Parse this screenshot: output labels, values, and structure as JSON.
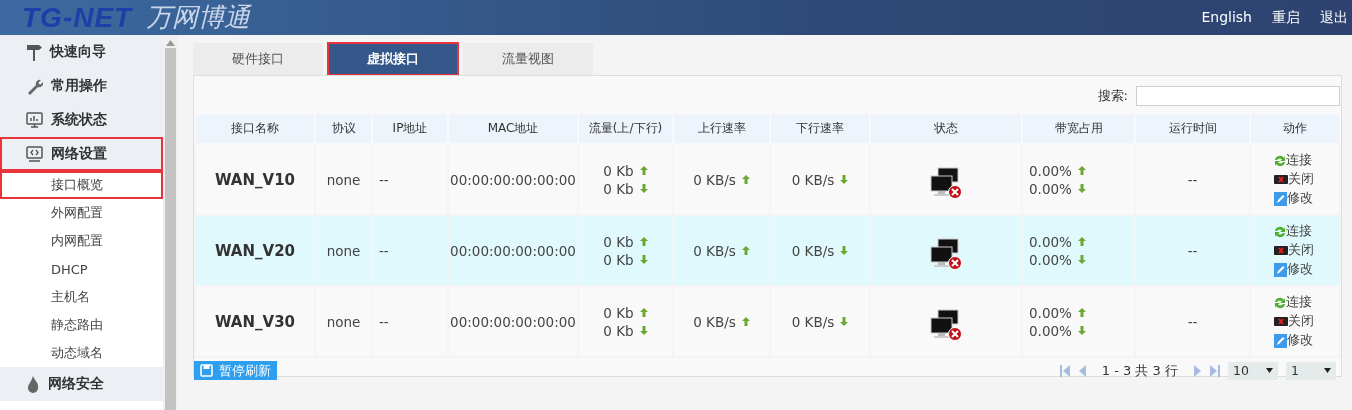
{
  "header": {
    "logo_latin": "TG-NET",
    "logo_cn": "万网博通",
    "links": [
      "English",
      "重启",
      "退出"
    ]
  },
  "sidebar": {
    "items": [
      {
        "label": "快速向导",
        "highlighted": false
      },
      {
        "label": "常用操作",
        "highlighted": false
      },
      {
        "label": "系统状态",
        "highlighted": false
      },
      {
        "label": "网络设置",
        "highlighted": true,
        "children": [
          {
            "label": "接口概览",
            "highlighted": true
          },
          {
            "label": "外网配置",
            "highlighted": false
          },
          {
            "label": "内网配置",
            "highlighted": false
          },
          {
            "label": "DHCP",
            "highlighted": false
          },
          {
            "label": "主机名",
            "highlighted": false
          },
          {
            "label": "静态路由",
            "highlighted": false
          },
          {
            "label": "动态域名",
            "highlighted": false
          }
        ]
      },
      {
        "label": "网络安全",
        "highlighted": false
      }
    ]
  },
  "tabs": [
    {
      "label": "硬件接口",
      "selected": false,
      "highlighted": false
    },
    {
      "label": "虚拟接口",
      "selected": true,
      "highlighted": true
    },
    {
      "label": "流量视图",
      "selected": false,
      "highlighted": false
    }
  ],
  "search": {
    "label": "搜索:"
  },
  "table": {
    "columns": [
      "接口名称",
      "协议",
      "IP地址",
      "MAC地址",
      "流量(上/下行)",
      "上行速率",
      "下行速率",
      "状态",
      "带宽占用",
      "运行时间",
      "动作"
    ],
    "rows": [
      {
        "name": "WAN_V10",
        "protocol": "none",
        "ip": "--",
        "mac": "00:00:00:00:00:00",
        "traffic_up": "0 Kb",
        "traffic_down": "0 Kb",
        "up_rate": "0 KB/s",
        "down_rate": "0 KB/s",
        "connected": false,
        "bandwidth_up": "0.00%",
        "bandwidth_down": "0.00%",
        "uptime": "--",
        "selected": false,
        "actions": [
          {
            "label": "连接",
            "kind": "connect"
          },
          {
            "label": "关闭",
            "kind": "close"
          },
          {
            "label": "修改",
            "kind": "edit"
          }
        ]
      },
      {
        "name": "WAN_V20",
        "protocol": "none",
        "ip": "--",
        "mac": "00:00:00:00:00:00",
        "traffic_up": "0 Kb",
        "traffic_down": "0 Kb",
        "up_rate": "0 KB/s",
        "down_rate": "0 KB/s",
        "connected": false,
        "bandwidth_up": "0.00%",
        "bandwidth_down": "0.00%",
        "uptime": "--",
        "selected": true,
        "actions": [
          {
            "label": "连接",
            "kind": "connect"
          },
          {
            "label": "关闭",
            "kind": "close"
          },
          {
            "label": "修改",
            "kind": "edit"
          }
        ]
      },
      {
        "name": "WAN_V30",
        "protocol": "none",
        "ip": "--",
        "mac": "00:00:00:00:00:00",
        "traffic_up": "0 Kb",
        "traffic_down": "0 Kb",
        "up_rate": "0 KB/s",
        "down_rate": "0 KB/s",
        "connected": false,
        "bandwidth_up": "0.00%",
        "bandwidth_down": "0.00%",
        "uptime": "--",
        "selected": false,
        "actions": [
          {
            "label": "连接",
            "kind": "connect"
          },
          {
            "label": "关闭",
            "kind": "close"
          },
          {
            "label": "修改",
            "kind": "edit"
          }
        ]
      }
    ]
  },
  "footer": {
    "pause_button": "暂停刷新",
    "page_info": "1 - 3 共 3 行",
    "page_size": "10",
    "page": "1"
  }
}
